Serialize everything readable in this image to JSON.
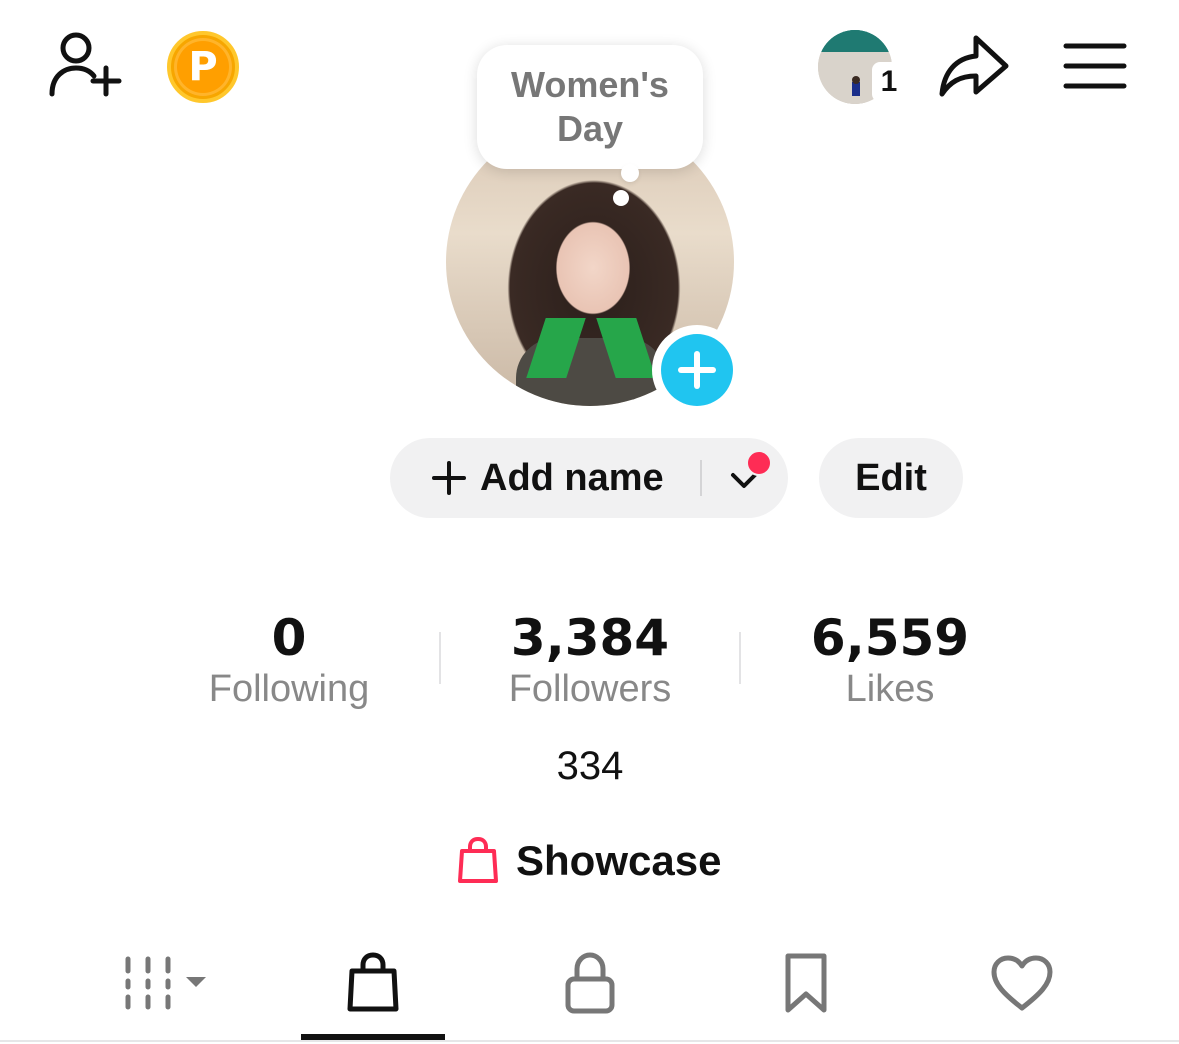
{
  "header": {
    "add_friend_icon": "person-add-icon",
    "points_badge_letter": "P",
    "points_color": "#ff9f00",
    "story_badge_count": "1",
    "share_icon": "share-arrow-icon",
    "menu_icon": "hamburger-icon"
  },
  "profile": {
    "note_text": "Women's Day",
    "avatar_add_color": "#20c5f0",
    "add_name_label": "Add name",
    "edit_label": "Edit",
    "notification_dot_color": "#fe2c55"
  },
  "stats": [
    {
      "value": "0",
      "label": "Following"
    },
    {
      "value": "3,384",
      "label": "Followers"
    },
    {
      "value": "6,559",
      "label": "Likes"
    }
  ],
  "bio": "334",
  "showcase": {
    "label": "Showcase",
    "icon_color": "#fe2c55"
  },
  "tabs": [
    {
      "icon": "videos-grid-icon",
      "active": false
    },
    {
      "icon": "shopping-bag-icon",
      "active": true
    },
    {
      "icon": "lock-icon",
      "active": false
    },
    {
      "icon": "bookmark-icon",
      "active": false
    },
    {
      "icon": "heart-icon",
      "active": false
    }
  ]
}
